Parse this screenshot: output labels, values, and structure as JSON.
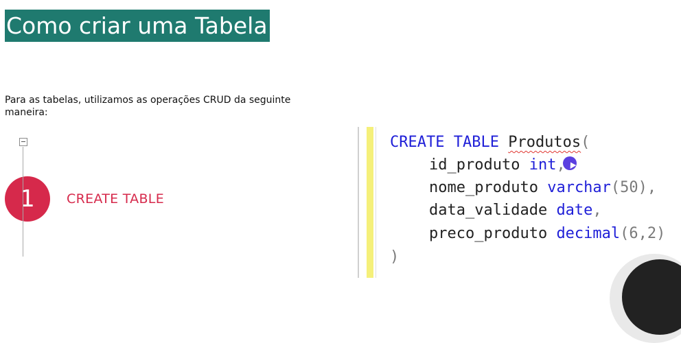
{
  "slide": {
    "title": "Como criar uma Tabela",
    "intro": "Para as tabelas, utilizamos as operações CRUD da seguinte maneira:",
    "step": {
      "number": "1",
      "label": "CREATE TABLE"
    }
  },
  "code": {
    "line1": {
      "keyword": "CREATE TABLE",
      "table_name": "Produtos",
      "paren": "("
    },
    "line2": {
      "column": "id_produto",
      "type": "int",
      "sep": ","
    },
    "line3": {
      "column": "nome_produto",
      "type": "varchar",
      "args": "(50)",
      "sep": ","
    },
    "line4": {
      "column": "data_validade",
      "type": "date",
      "sep": ","
    },
    "line5": {
      "column": "preco_produto",
      "type": "decimal",
      "args": "(6,2)"
    },
    "line6": {
      "paren": ")"
    }
  },
  "colors": {
    "title_bg": "#1f7a6f",
    "accent": "#d6294b",
    "keyword": "#2020d8",
    "change_bar": "#f5f07a",
    "cursor": "#5b3fe0"
  },
  "icons": [
    "collapse-minus-icon",
    "mouse-cursor-icon"
  ]
}
